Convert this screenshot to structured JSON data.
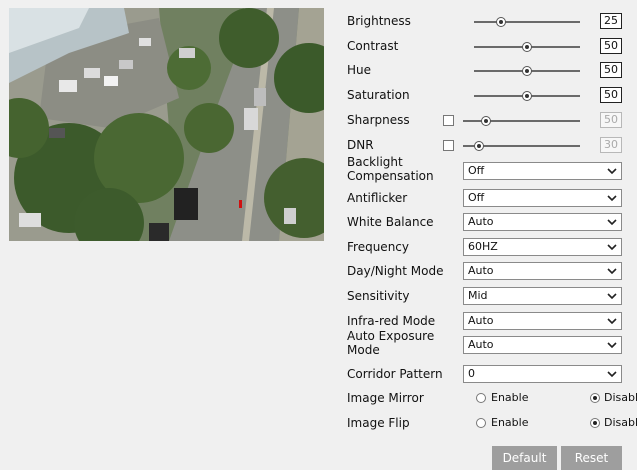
{
  "preview": {
    "scene": "overhead camera view of a tree-lined road with parked cars"
  },
  "sliders": [
    {
      "id": "brightness",
      "label": "Brightness",
      "value": "25",
      "position": 0.25,
      "enabled": true,
      "has_checkbox": false
    },
    {
      "id": "contrast",
      "label": "Contrast",
      "value": "50",
      "position": 0.5,
      "enabled": true,
      "has_checkbox": false
    },
    {
      "id": "hue",
      "label": "Hue",
      "value": "50",
      "position": 0.5,
      "enabled": true,
      "has_checkbox": false
    },
    {
      "id": "saturation",
      "label": "Saturation",
      "value": "50",
      "position": 0.5,
      "enabled": true,
      "has_checkbox": false
    },
    {
      "id": "sharpness",
      "label": "Sharpness",
      "value": "50",
      "position": 0.2,
      "enabled": false,
      "has_checkbox": true,
      "checked": false
    },
    {
      "id": "dnr",
      "label": "DNR",
      "value": "30",
      "position": 0.14,
      "enabled": false,
      "has_checkbox": true,
      "checked": false
    }
  ],
  "selects": [
    {
      "id": "backlight-compensation",
      "label": "Backlight Compensation",
      "value": "Off"
    },
    {
      "id": "antiflicker",
      "label": "Antiflicker",
      "value": "Off"
    },
    {
      "id": "white-balance",
      "label": "White Balance",
      "value": "Auto"
    },
    {
      "id": "frequency",
      "label": "Frequency",
      "value": "60HZ"
    },
    {
      "id": "day-night-mode",
      "label": "Day/Night Mode",
      "value": "Auto"
    },
    {
      "id": "sensitivity",
      "label": "Sensitivity",
      "value": "Mid"
    },
    {
      "id": "infra-red-mode",
      "label": "Infra-red Mode",
      "value": "Auto"
    },
    {
      "id": "auto-exposure-mode",
      "label": "Auto Exposure Mode",
      "value": "Auto"
    },
    {
      "id": "corridor-pattern",
      "label": "Corridor Pattern",
      "value": "0"
    }
  ],
  "radios": [
    {
      "id": "image-mirror",
      "label": "Image Mirror",
      "enable_label": "Enable",
      "disable_label": "Disable",
      "selected": "Disable"
    },
    {
      "id": "image-flip",
      "label": "Image Flip",
      "enable_label": "Enable",
      "disable_label": "Disable",
      "selected": "Disable"
    }
  ],
  "buttons": {
    "default_label": "Default",
    "reset_label": "Reset"
  },
  "colors": {
    "button_bg": "#9e9e9e",
    "track": "#6a6a6a",
    "background": "#f0f0f0"
  }
}
